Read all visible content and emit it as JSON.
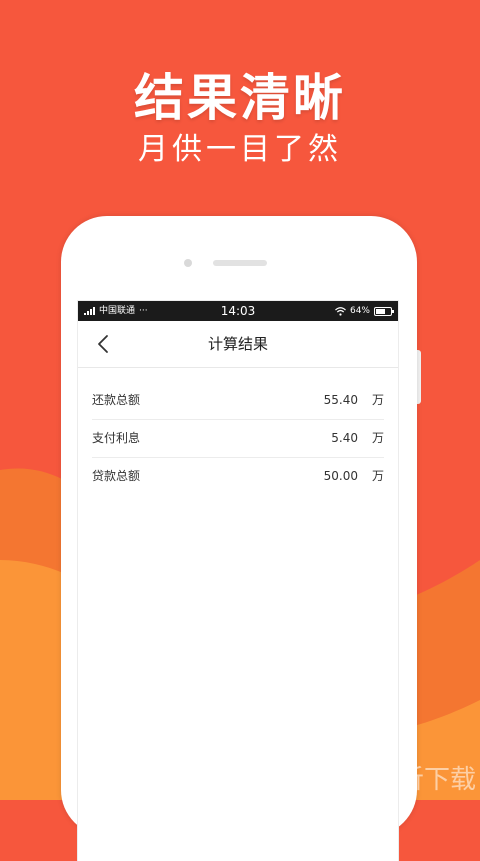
{
  "headline": "结果清晰",
  "subline": "月供一目了然",
  "status_bar": {
    "carrier": "中国联通",
    "extra": "···",
    "time": "14:03",
    "battery": "64%"
  },
  "nav": {
    "title": "计算结果"
  },
  "results": [
    {
      "label": "还款总额",
      "value": "55.40",
      "unit": "万"
    },
    {
      "label": "支付利息",
      "value": "5.40",
      "unit": "万"
    },
    {
      "label": "贷款总额",
      "value": "50.00",
      "unit": "万"
    }
  ],
  "watermark": {
    "icon_text": "听",
    "text": "一听下载"
  },
  "colors": {
    "background": "#f6573d",
    "wave_light": "#fb8f3a",
    "wave_dark": "#f06a2e"
  }
}
